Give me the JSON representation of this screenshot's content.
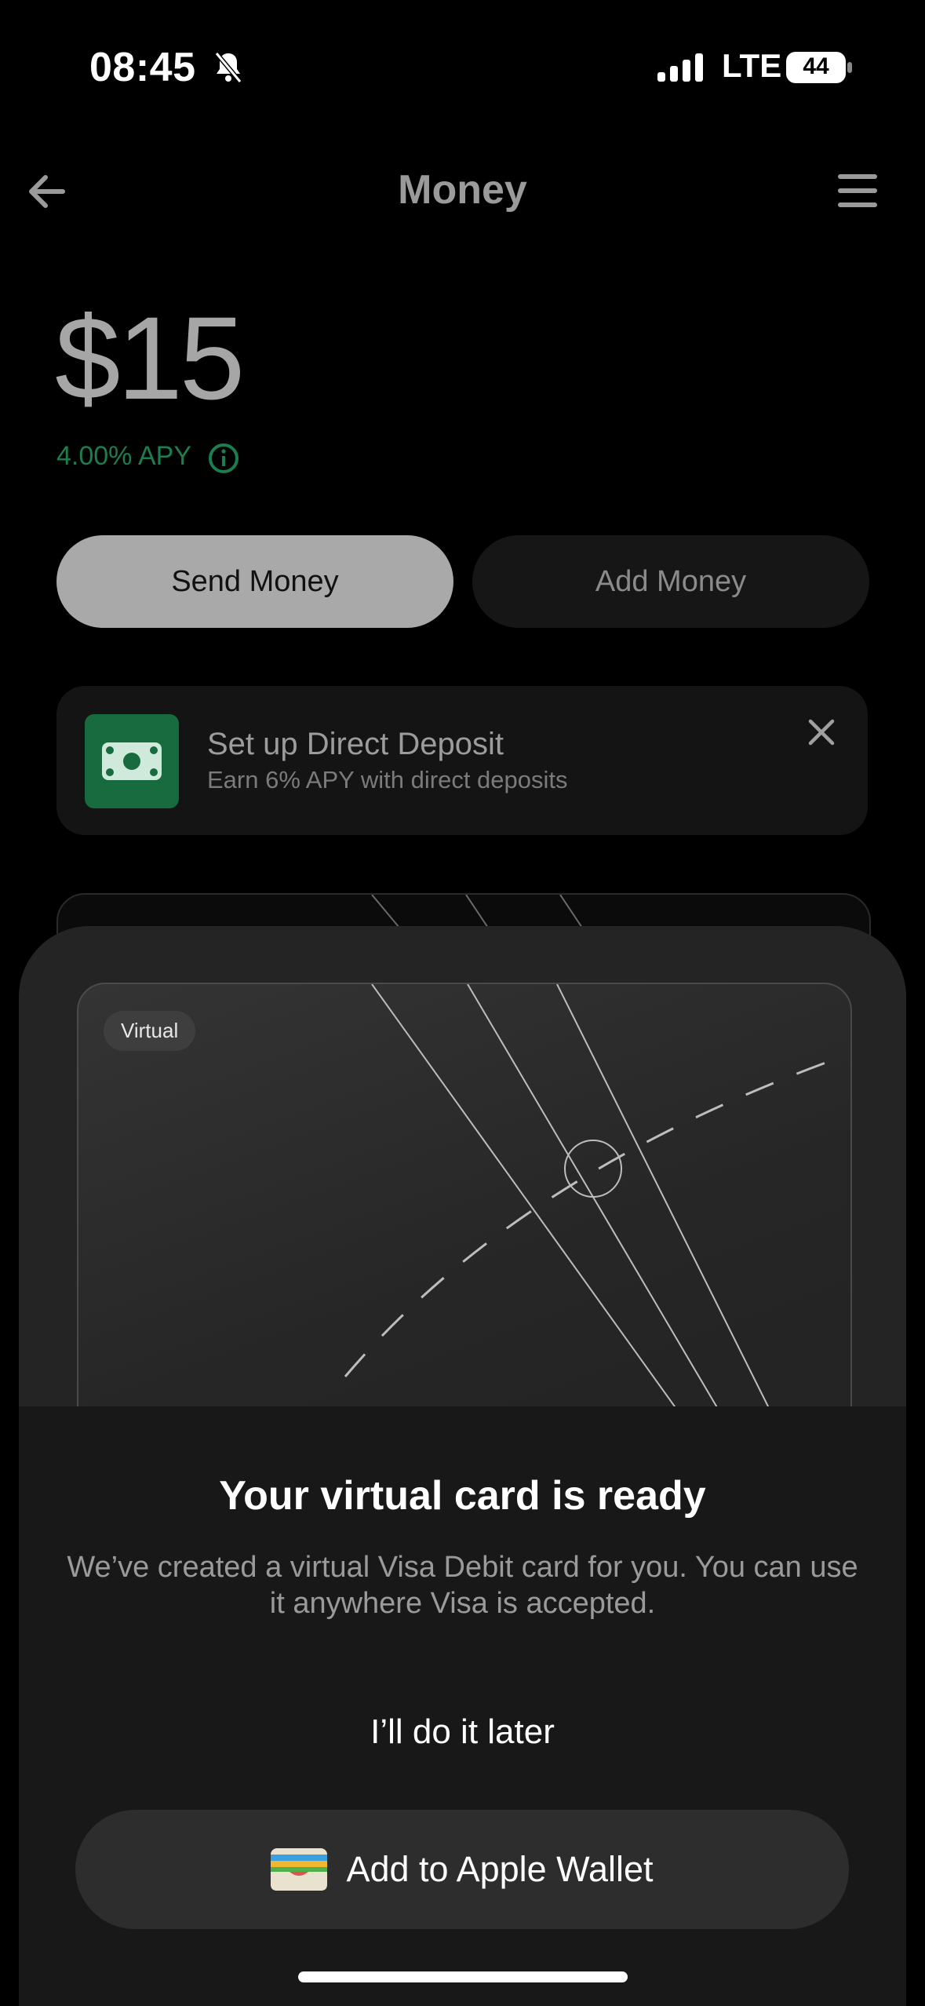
{
  "status_bar": {
    "time": "08:45",
    "network": "LTE",
    "battery": "44"
  },
  "header": {
    "title": "Money"
  },
  "balance": {
    "amount": "$15",
    "apy": "4.00% APY"
  },
  "actions": {
    "send_label": "Send Money",
    "add_label": "Add Money"
  },
  "direct_deposit": {
    "title": "Set up Direct Deposit",
    "subtitle": "Earn 6% APY with direct deposits"
  },
  "sheet": {
    "card_chip": "Virtual",
    "title": "Your virtual card is ready",
    "description": "We’ve created a virtual Visa Debit card for you. You can use it anywhere Visa is accepted.",
    "later_label": "I’ll do it later",
    "wallet_label": "Add to Apple Wallet"
  },
  "colors": {
    "accent_green": "#1c7e4e",
    "deposit_icon_bg": "#176b3f"
  }
}
